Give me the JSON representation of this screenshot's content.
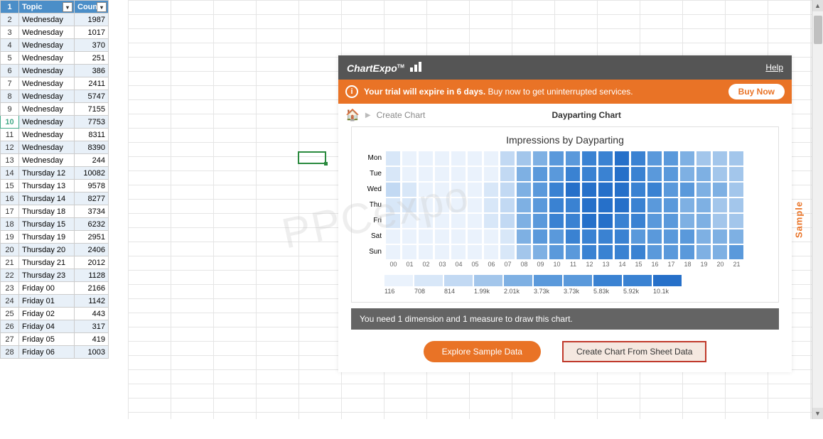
{
  "spreadsheet": {
    "headers": {
      "topic": "Topic",
      "count": "Count"
    },
    "rows": [
      {
        "n": 1,
        "a": "Topic",
        "b": "Count",
        "hdr": true
      },
      {
        "n": 2,
        "a": "Wednesday",
        "b": "1987"
      },
      {
        "n": 3,
        "a": "Wednesday",
        "b": "1017"
      },
      {
        "n": 4,
        "a": "Wednesday",
        "b": "370"
      },
      {
        "n": 5,
        "a": "Wednesday",
        "b": "251"
      },
      {
        "n": 6,
        "a": "Wednesday",
        "b": "386"
      },
      {
        "n": 7,
        "a": "Wednesday",
        "b": "2411"
      },
      {
        "n": 8,
        "a": "Wednesday",
        "b": "5747"
      },
      {
        "n": 9,
        "a": "Wednesday",
        "b": "7155"
      },
      {
        "n": 10,
        "a": "Wednesday",
        "b": "7753",
        "sel": true
      },
      {
        "n": 11,
        "a": "Wednesday",
        "b": "8311"
      },
      {
        "n": 12,
        "a": "Wednesday",
        "b": "8390"
      },
      {
        "n": 13,
        "a": "Wednesday",
        "b": "244"
      },
      {
        "n": 14,
        "a": "Thursday 12",
        "b": "10082"
      },
      {
        "n": 15,
        "a": "Thursday 13",
        "b": "9578"
      },
      {
        "n": 16,
        "a": "Thursday 14",
        "b": "8277"
      },
      {
        "n": 17,
        "a": "Thursday 18",
        "b": "3734"
      },
      {
        "n": 18,
        "a": "Thursday 15",
        "b": "6232"
      },
      {
        "n": 19,
        "a": "Thursday 19",
        "b": "2951"
      },
      {
        "n": 20,
        "a": "Thursday 20",
        "b": "2406"
      },
      {
        "n": 21,
        "a": "Thursday 21",
        "b": "2012"
      },
      {
        "n": 22,
        "a": "Thursday 23",
        "b": "1128"
      },
      {
        "n": 23,
        "a": "Friday 00",
        "b": "2166"
      },
      {
        "n": 24,
        "a": "Friday 01",
        "b": "1142"
      },
      {
        "n": 25,
        "a": "Friday 02",
        "b": "443"
      },
      {
        "n": 26,
        "a": "Friday 04",
        "b": "317"
      },
      {
        "n": 27,
        "a": "Friday 05",
        "b": "419"
      },
      {
        "n": 28,
        "a": "Friday 06",
        "b": "1003"
      }
    ]
  },
  "panel": {
    "logo": "ChartExpo",
    "tm": "TM",
    "help": "Help",
    "trial_msg_bold": "Your trial will expire in 6 days.",
    "trial_msg_rest": " Buy now to get uninterrupted services.",
    "buy": "Buy Now",
    "breadcrumb_create": "Create Chart",
    "breadcrumb_title": "Dayparting Chart",
    "chart_title": "Impressions by Dayparting",
    "req": "You need 1 dimension and 1 measure to draw this chart.",
    "explore": "Explore Sample Data",
    "create": "Create Chart From Sheet Data",
    "sample": "Sample",
    "watermark": "PPCexpo"
  },
  "chart_data": {
    "type": "heatmap",
    "title": "Impressions by Dayparting",
    "xlabel": "",
    "ylabel": "",
    "y_categories": [
      "Mon",
      "Tue",
      "Wed",
      "Thu",
      "Fri",
      "Sat",
      "Sun"
    ],
    "x_categories": [
      "00",
      "01",
      "02",
      "03",
      "04",
      "05",
      "06",
      "07",
      "08",
      "09",
      "10",
      "11",
      "12",
      "13",
      "14",
      "15",
      "16",
      "17",
      "18",
      "19",
      "20",
      "21"
    ],
    "legend_labels": [
      "116",
      "708",
      "814",
      "1.99k",
      "2.01k",
      "3.73k",
      "3.73k",
      "5.83k",
      "5.92k",
      "10.1k"
    ],
    "intensity": [
      [
        1,
        0,
        0,
        0,
        0,
        0,
        0,
        2,
        3,
        4,
        5,
        5,
        6,
        6,
        7,
        6,
        5,
        5,
        4,
        3,
        3,
        3
      ],
      [
        1,
        0,
        0,
        0,
        0,
        0,
        0,
        2,
        4,
        5,
        5,
        6,
        6,
        6,
        7,
        6,
        5,
        5,
        4,
        4,
        3,
        3
      ],
      [
        2,
        1,
        0,
        0,
        0,
        0,
        1,
        2,
        4,
        5,
        6,
        7,
        7,
        7,
        7,
        6,
        6,
        5,
        5,
        4,
        4,
        3
      ],
      [
        1,
        1,
        0,
        0,
        0,
        0,
        1,
        2,
        4,
        5,
        6,
        6,
        7,
        7,
        7,
        6,
        5,
        5,
        4,
        4,
        3,
        3
      ],
      [
        1,
        0,
        0,
        0,
        0,
        0,
        1,
        2,
        4,
        5,
        6,
        6,
        7,
        7,
        6,
        6,
        5,
        5,
        4,
        4,
        3,
        3
      ],
      [
        0,
        0,
        0,
        0,
        0,
        0,
        0,
        1,
        4,
        5,
        5,
        6,
        6,
        6,
        6,
        5,
        5,
        5,
        5,
        4,
        4,
        4
      ],
      [
        0,
        0,
        0,
        0,
        0,
        0,
        0,
        1,
        3,
        4,
        5,
        5,
        6,
        6,
        6,
        6,
        5,
        5,
        5,
        4,
        4,
        5
      ]
    ]
  }
}
